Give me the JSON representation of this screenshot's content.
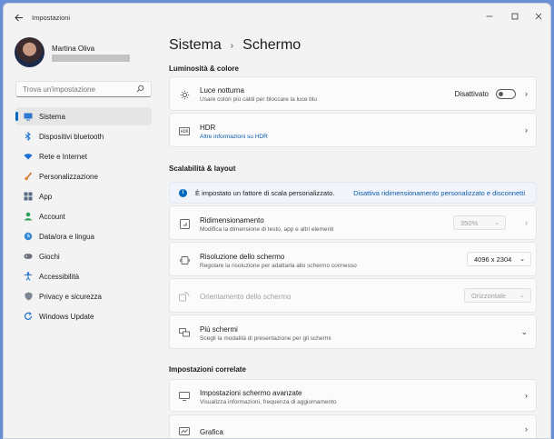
{
  "window": {
    "title": "Impostazioni"
  },
  "profile": {
    "name": "Martina Oliva"
  },
  "search": {
    "placeholder": "Trova un'impostazione"
  },
  "nav": [
    {
      "label": "Sistema",
      "icon": "display-icon",
      "active": true
    },
    {
      "label": "Dispositivi bluetooth",
      "icon": "bluetooth-icon"
    },
    {
      "label": "Rete e Internet",
      "icon": "wifi-icon"
    },
    {
      "label": "Personalizzazione",
      "icon": "brush-icon"
    },
    {
      "label": "App",
      "icon": "apps-icon"
    },
    {
      "label": "Account",
      "icon": "person-icon"
    },
    {
      "label": "Data/ora e lingua",
      "icon": "globe-clock-icon"
    },
    {
      "label": "Giochi",
      "icon": "gamepad-icon"
    },
    {
      "label": "Accessibilità",
      "icon": "accessibility-icon"
    },
    {
      "label": "Privacy e sicurezza",
      "icon": "shield-icon"
    },
    {
      "label": "Windows Update",
      "icon": "update-icon"
    }
  ],
  "breadcrumb": {
    "parent": "Sistema",
    "current": "Schermo"
  },
  "sections": {
    "brightness": "Luminosità & colore",
    "scale": "Scalabilità & layout",
    "related": "Impostazioni correlate"
  },
  "cards": {
    "night_light": {
      "title": "Luce notturna",
      "subtitle": "Usare colori più caldi per bloccare la luce blu",
      "toggle_label": "Disattivato"
    },
    "hdr": {
      "title": "HDR",
      "link": "Altre informazioni su HDR"
    },
    "info": {
      "text": "È impostato un fattore di scala personalizzato.",
      "link": "Disattiva ridimensionamento personalizzato e disconnetti"
    },
    "scale": {
      "title": "Ridimensionamento",
      "subtitle": "Modifica la dimensione di testo, app e altri elementi",
      "value": "350%"
    },
    "resolution": {
      "title": "Risoluzione dello schermo",
      "subtitle": "Regolare la risoluzione per adattarla allo schermo connesso",
      "value": "4096 x 2304"
    },
    "orientation": {
      "title": "Orientamento dello schermo",
      "value": "Orizzontale"
    },
    "multi": {
      "title": "Più schermi",
      "subtitle": "Scegli la modalità di presentazione per gli schermi"
    },
    "advanced": {
      "title": "Impostazioni schermo avanzate",
      "subtitle": "Visualizza informazioni, frequenza di aggiornamento"
    },
    "graphics": {
      "title": "Grafica"
    }
  },
  "colors": {
    "accent": "#0067c0",
    "link": "#0b5cad",
    "background": "#f3f3f3"
  }
}
